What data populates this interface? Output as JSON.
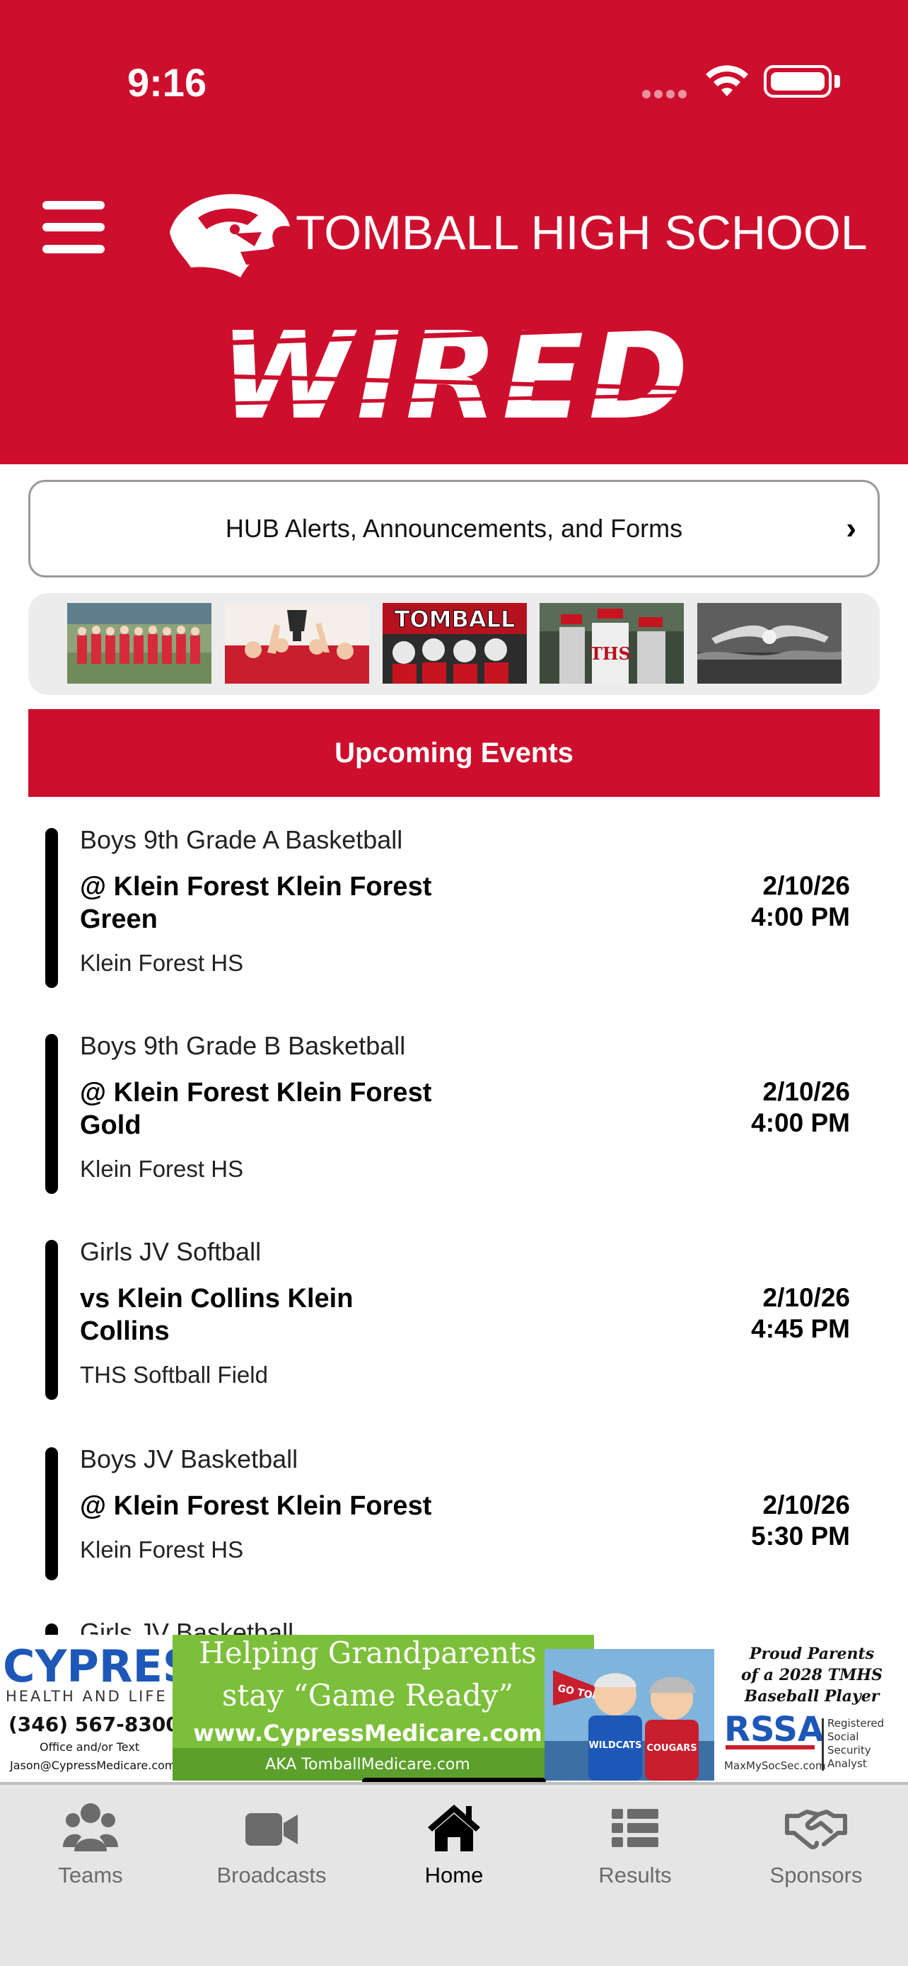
{
  "status_bar": {
    "time": "9:16"
  },
  "header": {
    "school_name": "TOMBALL HIGH SCHOOL",
    "app_name": "WIRED",
    "brand_color": "#CE0E2D"
  },
  "hub": {
    "label": "HUB Alerts, Announcements, and Forms"
  },
  "photo_strip": {
    "photos": [
      {
        "name": "team-photo"
      },
      {
        "name": "trophy-celebration"
      },
      {
        "name": "tomball-football",
        "text": "TOMBALL"
      },
      {
        "name": "baseball-players",
        "text": "THS"
      },
      {
        "name": "swimmer"
      }
    ]
  },
  "events_section": {
    "title": "Upcoming Events"
  },
  "events": [
    {
      "sport": "Boys 9th Grade A Basketball",
      "opponent": "@ Klein Forest Klein Forest Green",
      "location": "Klein Forest HS",
      "date": "2/10/26",
      "time": "4:00 PM"
    },
    {
      "sport": "Boys 9th Grade B Basketball",
      "opponent": "@ Klein Forest Klein Forest Gold",
      "location": "Klein Forest HS",
      "date": "2/10/26",
      "time": "4:00 PM"
    },
    {
      "sport": "Girls JV Softball",
      "opponent": "vs Klein Collins Klein Collins",
      "location": "THS Softball Field",
      "date": "2/10/26",
      "time": "4:45 PM"
    },
    {
      "sport": "Boys JV Basketball",
      "opponent": "@ Klein Forest Klein Forest",
      "location": "Klein Forest HS",
      "date": "2/10/26",
      "time": "5:30 PM"
    },
    {
      "sport": "Girls JV Basketball"
    }
  ],
  "ad": {
    "brand": "CYPRESS",
    "brand_sub": "HEALTH AND LIFE",
    "phone": "(346) 567-8300",
    "office_text": "Office and/or Text",
    "email": "Jason@CypressMedicare.com",
    "headline_1": "Helping Grandparents",
    "headline_2": "stay “Game Ready”",
    "website": "www.CypressMedicare.com",
    "aka": "AKA TomballMedicare.com",
    "pennant": "GO TOMBALL",
    "shirt_1": "WILDCATS",
    "shirt_2": "COUGARS",
    "proud_1": "Proud Parents",
    "proud_2": "of a 2028 TMHS",
    "proud_3": "Baseball Player",
    "rssa": "RSSA",
    "rssa_sub": "Registered Social Security Analyst",
    "rssa_site": "MaxMySocSec.com"
  },
  "tabs": [
    {
      "label": "Teams",
      "icon": "users-icon",
      "active": false
    },
    {
      "label": "Broadcasts",
      "icon": "video-camera-icon",
      "active": false
    },
    {
      "label": "Home",
      "icon": "home-icon",
      "active": true
    },
    {
      "label": "Results",
      "icon": "list-icon",
      "active": false
    },
    {
      "label": "Sponsors",
      "icon": "handshake-icon",
      "active": false
    }
  ]
}
